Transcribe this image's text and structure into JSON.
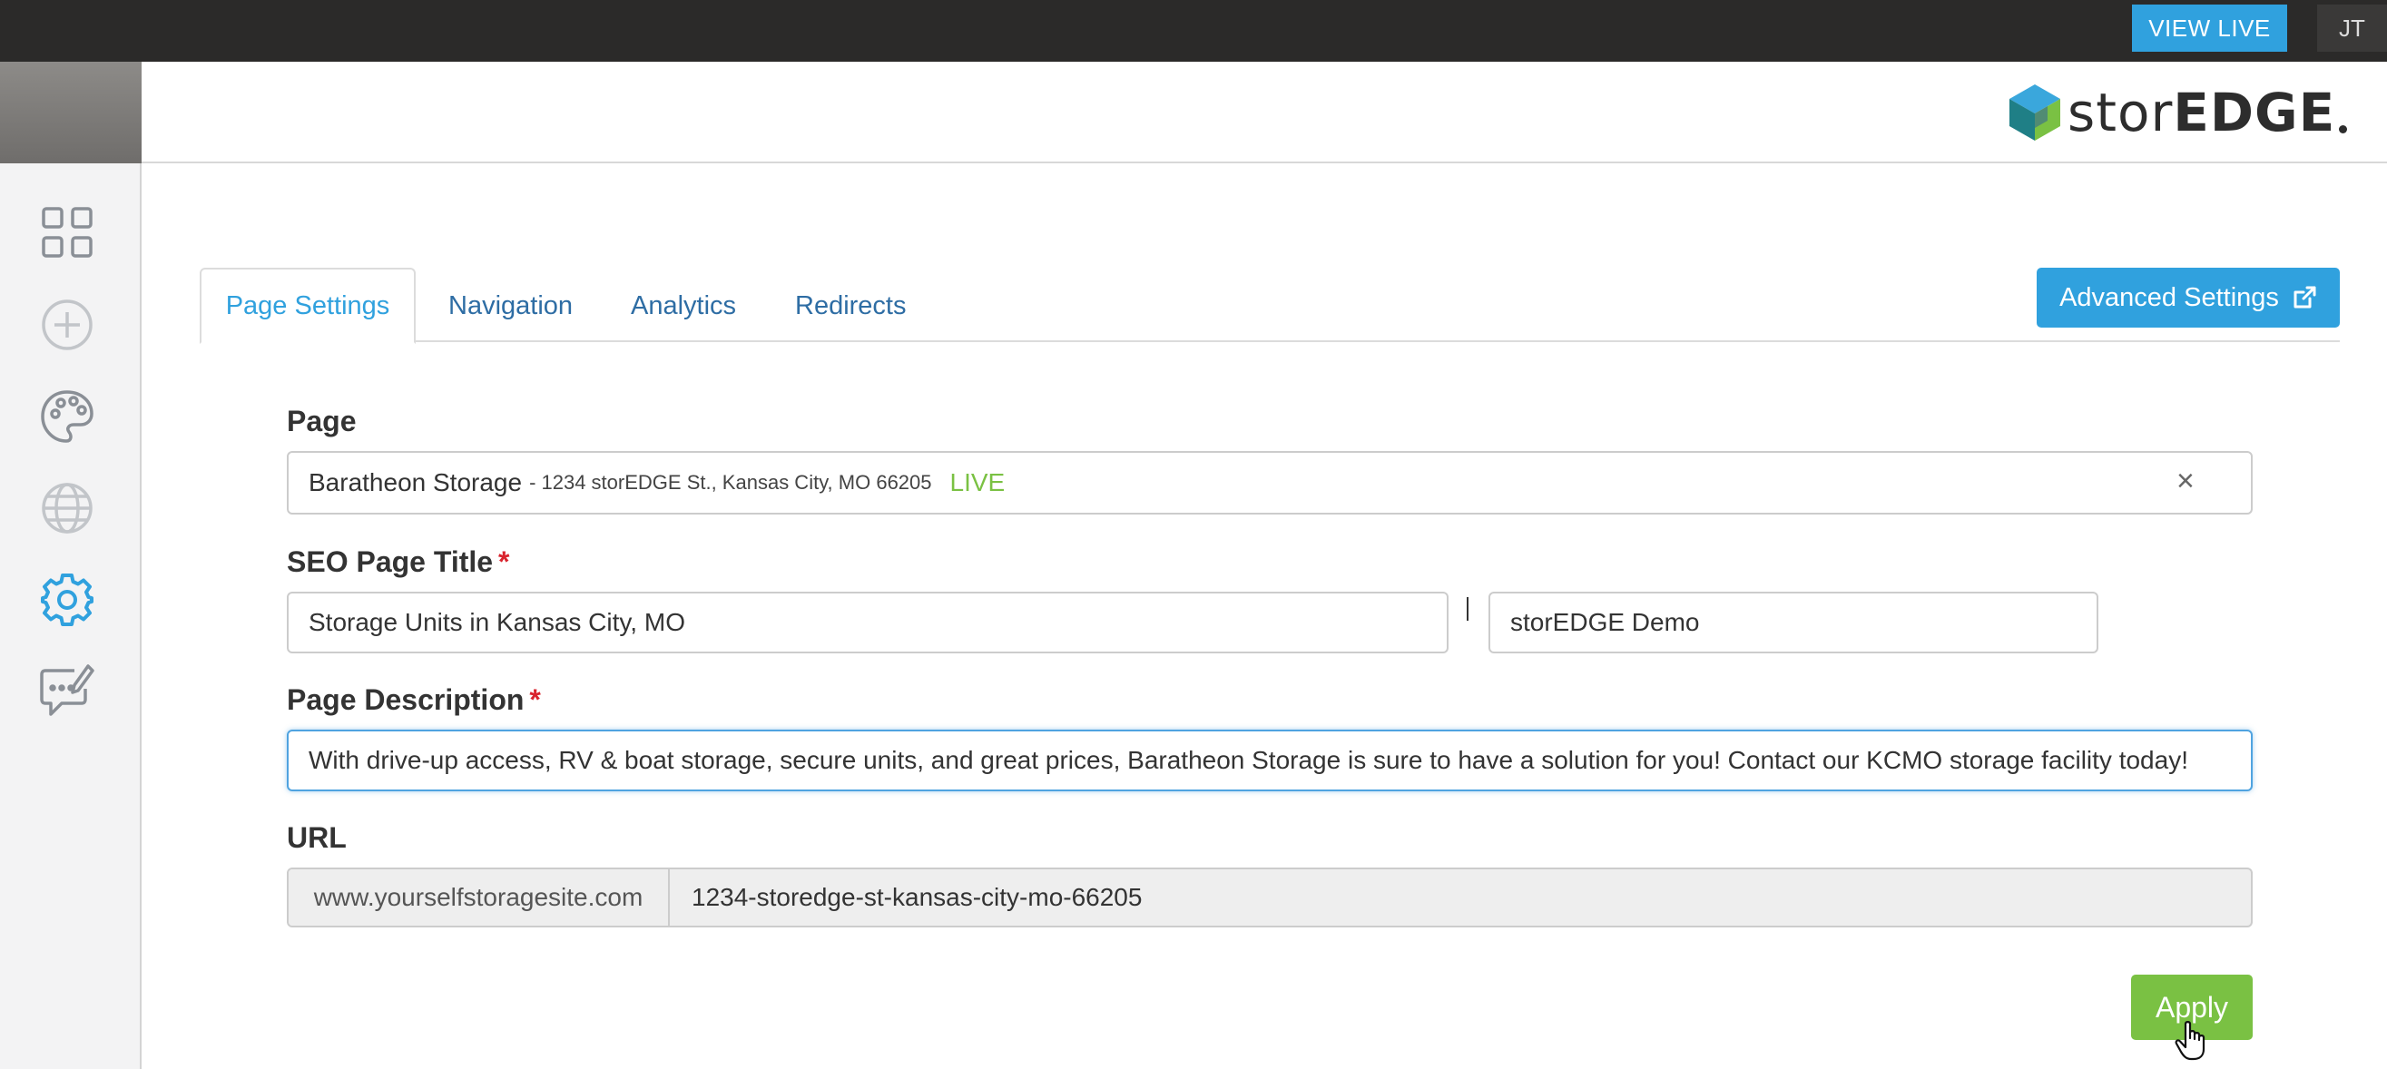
{
  "topbar": {
    "view_live_label": "VIEW LIVE",
    "user_initials": "JT"
  },
  "header": {
    "logo_text_light": "stor",
    "logo_text_bold": "EDGE"
  },
  "sidebar": {
    "items": [
      {
        "icon": "grid-icon"
      },
      {
        "icon": "add-circle-icon"
      },
      {
        "icon": "palette-icon"
      },
      {
        "icon": "globe-icon"
      },
      {
        "icon": "gear-icon",
        "active": true
      },
      {
        "icon": "edit-message-icon"
      }
    ]
  },
  "tabs": [
    {
      "label": "Page Settings",
      "active": true
    },
    {
      "label": "Navigation"
    },
    {
      "label": "Analytics"
    },
    {
      "label": "Redirects"
    }
  ],
  "advanced_settings_label": "Advanced Settings",
  "form": {
    "page": {
      "label": "Page",
      "name": "Baratheon Storage",
      "address": "- 1234 storEDGE St., Kansas City, MO 66205",
      "status": "LIVE",
      "clear_symbol": "×"
    },
    "seo_title": {
      "label": "SEO Page Title",
      "required_mark": "*",
      "value": "Storage Units in Kansas City, MO",
      "suffix_value": "storEDGE Demo"
    },
    "description": {
      "label": "Page Description",
      "required_mark": "*",
      "value": "With drive-up access, RV & boat storage, secure units, and great prices, Baratheon Storage is sure to have a solution for you! Contact our KCMO storage facility today!"
    },
    "url": {
      "label": "URL",
      "prefix": "www.yourselfstoragesite.com",
      "slug": "1234-storedge-st-kansas-city-mo-66205"
    },
    "apply_label": "Apply"
  },
  "colors": {
    "accent_blue": "#30a1de",
    "link_blue": "#2e6da4",
    "success_green": "#7ac143",
    "required_red": "#d9232d",
    "topbar_dark": "#2b2a29"
  }
}
